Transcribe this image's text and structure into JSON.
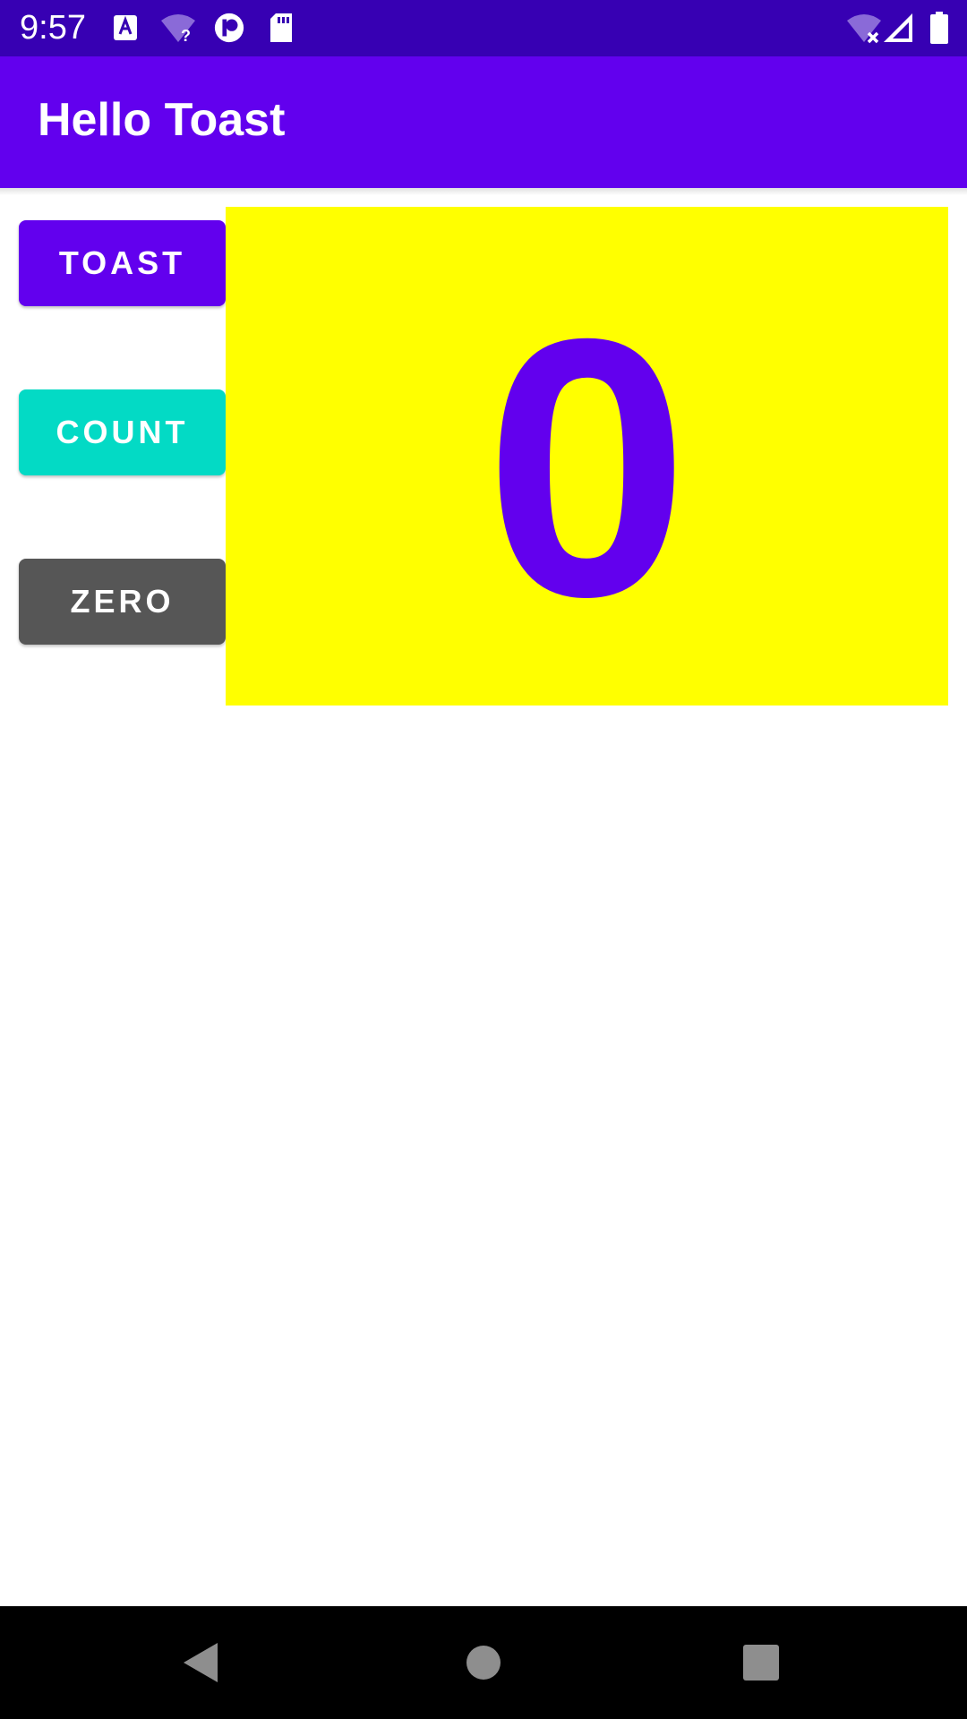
{
  "status_bar": {
    "time": "9:57",
    "background": "#3700b3",
    "icons": [
      "text-a-icon",
      "wifi-question-icon",
      "circle-badge-icon",
      "sd-card-icon",
      "wifi-off-icon",
      "signal-icon",
      "battery-icon"
    ]
  },
  "app_bar": {
    "title": "Hello Toast",
    "background": "#6200ee"
  },
  "buttons": {
    "toast": {
      "label": "TOAST",
      "color": "#6200ee"
    },
    "count": {
      "label": "COUNT",
      "color": "#03dac5"
    },
    "zero": {
      "label": "ZERO",
      "color": "#565656"
    }
  },
  "counter": {
    "value": "0",
    "background": "#ffff00",
    "text_color": "#6200ee"
  },
  "nav_bar": {
    "icons": [
      "back-icon",
      "home-icon",
      "recents-icon"
    ]
  }
}
